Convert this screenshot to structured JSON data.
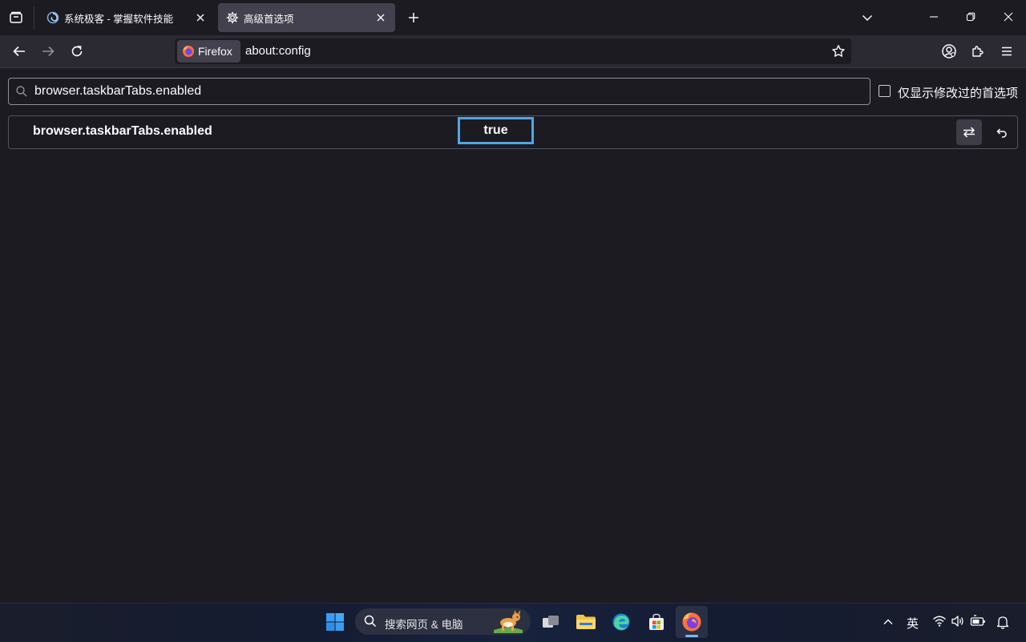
{
  "tabs": [
    {
      "title": "系统极客 - 掌握软件技能",
      "favicon": "site-swirl-icon",
      "active": false
    },
    {
      "title": "高级首选项",
      "favicon": "gear-icon",
      "active": true
    }
  ],
  "urlbar": {
    "identity_label": "Firefox",
    "url": "about:config"
  },
  "config": {
    "search_value": "browser.taskbarTabs.enabled",
    "modified_only_label": "仅显示修改过的首选项",
    "modified_only_checked": false,
    "prefs": [
      {
        "name": "browser.taskbarTabs.enabled",
        "value": "true"
      }
    ]
  },
  "taskbar": {
    "search_placeholder": "搜索网页 & 电脑",
    "apps": [
      "start-icon",
      "task-view-icon",
      "file-explorer-icon",
      "edge-icon",
      "store-icon",
      "firefox-icon"
    ],
    "ime_label": "英"
  },
  "colors": {
    "accent": "#4fa7e3",
    "background": "#1c1b22",
    "toolbar": "#2b2a33",
    "active_tab": "#42414d"
  }
}
